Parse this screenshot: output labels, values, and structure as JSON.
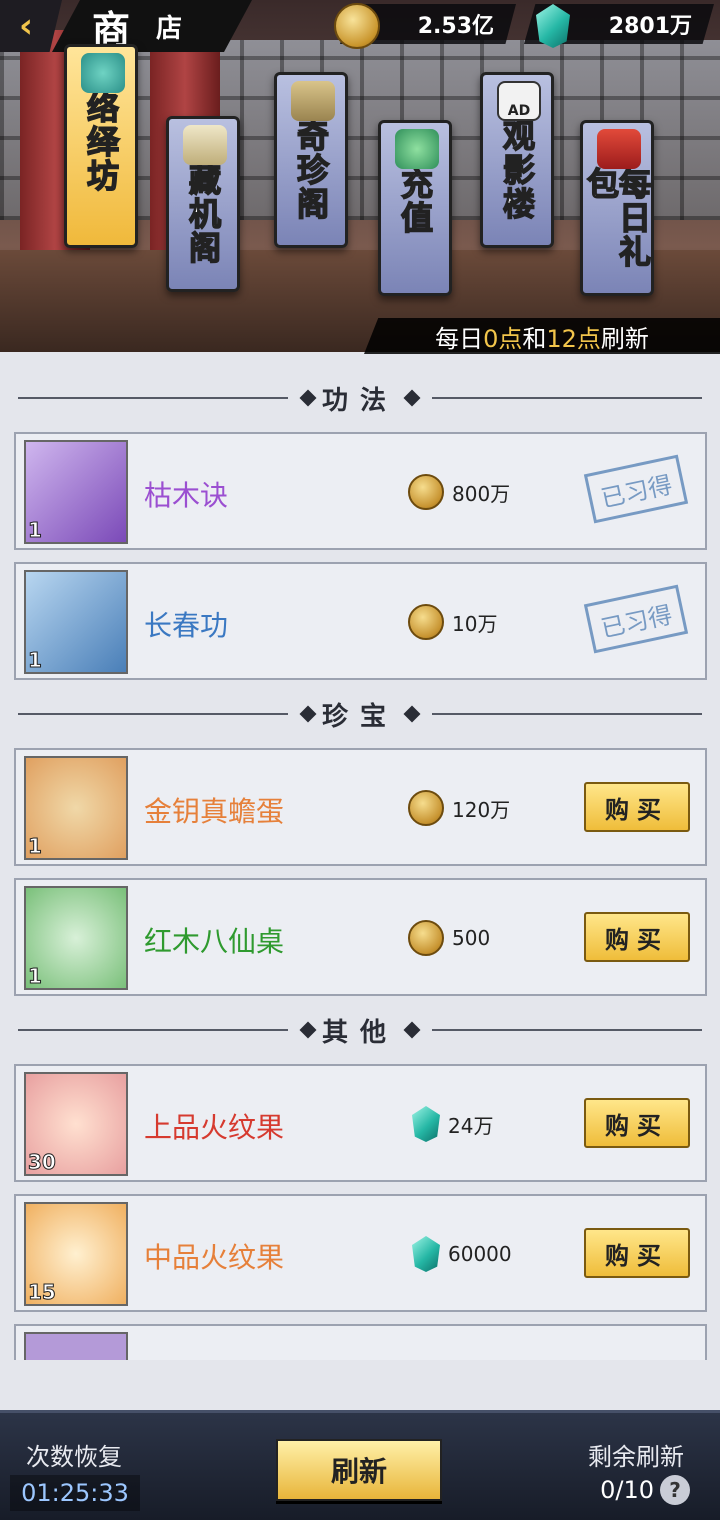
{
  "header": {
    "title_big": "商",
    "title_small": "店",
    "gold": "2.53亿",
    "gems": "2801万",
    "refresh_prefix": "每日",
    "refresh_time1": "0点",
    "refresh_mid": "和",
    "refresh_time2": "12点",
    "refresh_suffix": "刷新"
  },
  "tabs": [
    {
      "label": "络绎坊",
      "active": true,
      "icon": "dragon-icon"
    },
    {
      "label": "藏机阁",
      "active": false,
      "icon": "scroll-icon"
    },
    {
      "label": "奇珍阁",
      "active": false,
      "icon": "book-icon"
    },
    {
      "label": "充值",
      "active": false,
      "icon": "jade-icon"
    },
    {
      "label": "观影楼",
      "active": false,
      "icon": "ad-clapper-icon"
    },
    {
      "label": "每日礼包",
      "active": false,
      "icon": "giftbox-icon"
    }
  ],
  "sections": {
    "s1": "功法",
    "s2": "珍宝",
    "s3": "其他"
  },
  "items": [
    {
      "name": "枯木诀",
      "count": "1",
      "price": "800万",
      "currency": "gold",
      "status": "已习得",
      "color": "#9b4fd1"
    },
    {
      "name": "长春功",
      "count": "1",
      "price": "10万",
      "currency": "gold",
      "status": "已习得",
      "color": "#3a78c2"
    },
    {
      "name": "金钥真蟾蛋",
      "count": "1",
      "price": "120万",
      "currency": "gold",
      "action": "购买",
      "color": "#e6803a"
    },
    {
      "name": "红木八仙桌",
      "count": "1",
      "price": "500",
      "currency": "gold",
      "action": "购买",
      "color": "#2f9a2f"
    },
    {
      "name": "上品火纹果",
      "count": "30",
      "price": "24万",
      "currency": "gem",
      "action": "购买",
      "color": "#d63a2f"
    },
    {
      "name": "中品火纹果",
      "count": "15",
      "price": "60000",
      "currency": "gem",
      "action": "购买",
      "color": "#e6803a"
    }
  ],
  "bottom": {
    "recover_label": "次数恢复",
    "recover_time": "01:25:33",
    "refresh_button": "刷新",
    "remain_label": "剩余刷新",
    "remain_value": "0/10",
    "help": "?"
  }
}
